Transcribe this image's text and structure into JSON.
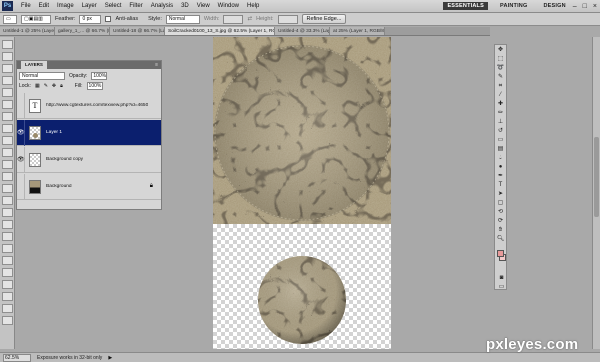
{
  "menu": [
    "File",
    "Edit",
    "Image",
    "Layer",
    "Select",
    "Filter",
    "Analysis",
    "3D",
    "View",
    "Window",
    "Help"
  ],
  "workspaces": [
    "ESSENTIALS",
    "PAINTING",
    "DESIGN"
  ],
  "options": {
    "feather_label": "Feather:",
    "feather_value": "0 px",
    "antialias_label": "Anti-alias",
    "style_label": "Style:",
    "style_value": "Normal",
    "width_label": "Width:",
    "height_label": "Height:",
    "refine_label": "Refine Edge..."
  },
  "tabs": [
    "Untitled-1 @ 25% (Layer 1, RGB/8)",
    "gallery_1_... @ 66.7% (Layer 1, RGB/8)",
    "Untitled-18 @ 66.7% (Layer 1, RGB...)",
    "SoilCracked0100_13_S.jpg @ 62.5% (Layer 1, RGB/8) *",
    "Untitled-4 @ 33.3% (Layer 2, RGB/8)",
    "at 25% (Layer 1, RGB/8)"
  ],
  "layers_panel": {
    "tab_label": "LAYERS",
    "blend_mode": "Normal",
    "opacity_label": "Opacity:",
    "opacity_value": "100%",
    "lock_label": "Lock:",
    "fill_label": "Fill:",
    "fill_value": "100%",
    "layers": [
      {
        "name": "http://www.cgtextures.com/texview.php?id=4650",
        "type": "text",
        "visible": false,
        "selected": false
      },
      {
        "name": "Layer 1",
        "type": "pixel",
        "visible": true,
        "selected": true
      },
      {
        "name": "Background copy",
        "type": "pixel",
        "visible": true,
        "selected": false
      },
      {
        "name": "Background",
        "type": "background",
        "visible": false,
        "selected": false,
        "locked": true
      }
    ]
  },
  "status": {
    "zoom": "62.5%",
    "message": "Exposure works in 32-bit only"
  },
  "watermark": "pxleyes.com",
  "colors": {
    "selection_blue": "#0b1f6e",
    "foreground_swatch": "#e89a9a",
    "background_swatch": "#f2c9c9"
  }
}
